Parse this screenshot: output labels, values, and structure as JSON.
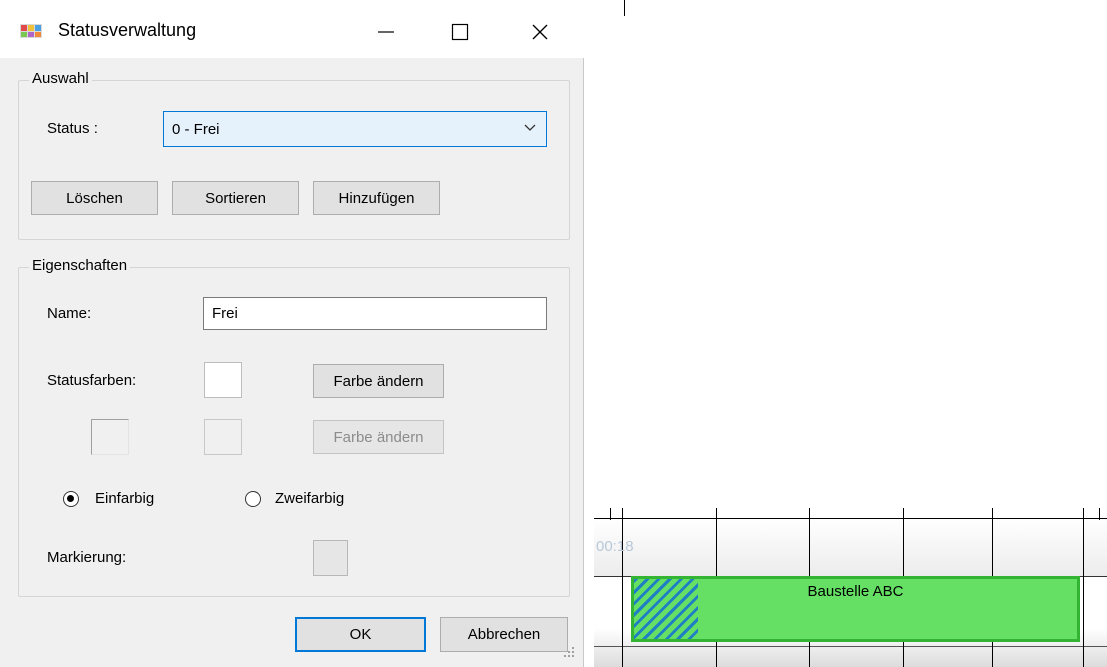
{
  "dialog": {
    "title": "Statusverwaltung",
    "auswahl": {
      "legend": "Auswahl",
      "status_label": "Status :",
      "status_value": "0 - Frei",
      "buttons": {
        "delete": "Löschen",
        "sort": "Sortieren",
        "add": "Hinzufügen"
      }
    },
    "eigenschaften": {
      "legend": "Eigenschaften",
      "name_label": "Name:",
      "name_value": "Frei",
      "statusfarben_label": "Statusfarben:",
      "change_color_1": "Farbe ändern",
      "change_color_2": "Farbe ändern",
      "radio_single": "Einfarbig",
      "radio_double": "Zweifarbig",
      "radio_selected": "Einfarbig",
      "markierung_label": "Markierung:"
    },
    "footer": {
      "ok": "OK",
      "cancel": "Abbrechen"
    }
  },
  "gantt": {
    "time_label": "00:18",
    "bar_label": "Baustelle ABC",
    "bar_color": "#65e065",
    "hatch_color": "#1f7fc4"
  }
}
